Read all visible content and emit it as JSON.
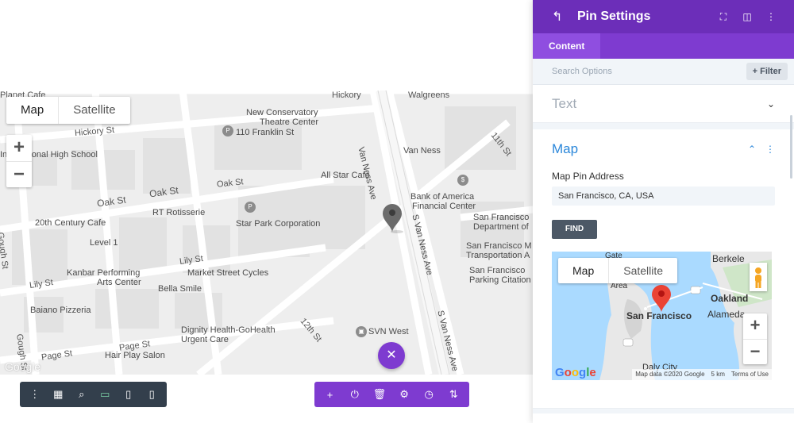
{
  "canvas_map": {
    "map_type": {
      "map_label": "Map",
      "satellite_label": "Satellite"
    },
    "zoom": {
      "in": "+",
      "out": "−"
    },
    "watermark": "Google",
    "labels": {
      "planet_cafe": "Planet Cafe",
      "walgreens": "Walgreens",
      "hickory_top": "Hickory",
      "hickory_st": "Hickory St",
      "new_conservatory": "New Conservatory",
      "theatre_center": "Theatre Center",
      "franklin": "110 Franklin St",
      "van_ness_ave": "Van Ness Ave",
      "van_ness": "Van Ness",
      "eleventh_st": "11th St",
      "international_high": "International High School",
      "all_star": "All Star Cafe",
      "oak_st_a": "Oak St",
      "oak_st_b": "Oak St",
      "oak_st_c": "Oak St",
      "rt_rotisserie": "RT Rotisserie",
      "bank_of_america": "Bank of America",
      "financial_center": "Financial Center",
      "s_van_ness_ave": "S Van Ness Ave",
      "s_van_ness_ave_2": "S Van Ness Ave",
      "sf_dept": "San Francisco",
      "sf_dept_2": "Department of",
      "twentieth_century": "20th Century Cafe",
      "star_park": "Star Park Corporation",
      "sf_mta": "San Francisco M",
      "sf_mta_2": "Transportation A",
      "level_1": "Level 1",
      "gough_st": "Gough St",
      "lily_st": "Lily St",
      "lily_st_2": "Lily St",
      "kanbar": "Kanbar Performing",
      "arts_center": "Arts Center",
      "market_street_cycles": "Market Street Cycles",
      "sf_parking": "San Francisco",
      "parking_citation": "Parking Citation",
      "bella_smile": "Bella Smile",
      "baiano": "Baiano Pizzeria",
      "dignity": "Dignity Health-GoHealth",
      "urgent_care": "Urgent Care",
      "twelfth_st": "12th St",
      "svn_west": "SVN West",
      "gough_st_2": "Gough St",
      "page_st": "Page St",
      "hair_play": "Hair Play Salon"
    }
  },
  "toolbar_left": {
    "icons": [
      "more-vertical-icon",
      "layout-icon",
      "zoom-icon",
      "desktop-icon",
      "tablet-icon",
      "phone-icon"
    ],
    "glyphs": [
      "⋮",
      "▦",
      "⌕",
      "▭",
      "▯",
      "▯"
    ]
  },
  "toolbar_right": {
    "icons": [
      "add-icon",
      "power-icon",
      "trash-icon",
      "gear-icon",
      "history-icon",
      "sort-icon"
    ],
    "glyphs": [
      "+",
      "⏻",
      "🗑",
      "⚙",
      "◷",
      "⇅"
    ]
  },
  "close_fab": {
    "glyph": "✕"
  },
  "panel": {
    "title": "Pin Settings",
    "header_glyphs": {
      "back": "↰",
      "expand": "⛶",
      "columns": "◫",
      "more": "⋮"
    },
    "tabs": [
      {
        "label": "Content"
      }
    ],
    "search": {
      "placeholder": "Search Options",
      "filter_label": "+ Filter"
    },
    "sections": {
      "text": {
        "title": "Text",
        "chevron": "⌄"
      },
      "map": {
        "title": "Map",
        "chevron": "⌃",
        "more": "⋮",
        "field_label": "Map Pin Address",
        "address_value": "San Francisco, CA, USA",
        "find_label": "FIND"
      }
    },
    "mini_map": {
      "map_label": "Map",
      "satellite_label": "Satellite",
      "zoom_in": "+",
      "zoom_out": "−",
      "watermark": "Google",
      "attribution": "Map data ©2020 Google",
      "scale": "5 km",
      "terms": "Terms of Use",
      "labels": {
        "berkeley": "Berkele",
        "oakland": "Oakland",
        "alameda": "Alameda",
        "san_francisco": "San Francisco",
        "daly_city": "Daly City",
        "gate": "Gate",
        "area": "Area"
      }
    }
  },
  "colors": {
    "purple_dark": "#6c2eb9",
    "purple": "#7e3bd0",
    "blue_accent": "#2b87da",
    "toolbar_dark": "#333f4c",
    "pin_red": "#ea4335"
  }
}
